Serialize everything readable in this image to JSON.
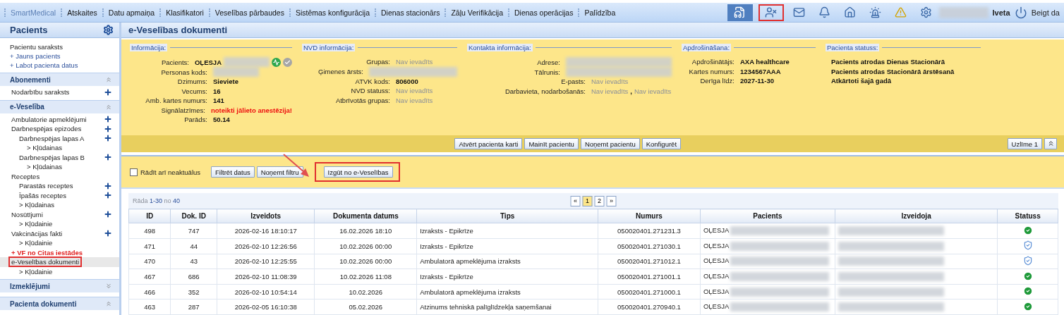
{
  "top_nav": {
    "brand": "SmartMedical",
    "items": [
      "Atskaites",
      "Datu apmaiņa",
      "Klasifikatori",
      "Veselības pārbaudes",
      "Sistēmas konfigurācija",
      "Dienas stacionārs",
      "Zāļu Verifikācija",
      "Dienas operācijas",
      "Palīdzība"
    ],
    "tools": [
      {
        "kind": "dictation",
        "active": true,
        "highlighted": false
      },
      {
        "kind": "patient-off",
        "active": false,
        "highlighted": true
      },
      {
        "kind": "mail",
        "active": false,
        "highlighted": false
      },
      {
        "kind": "bell",
        "active": false,
        "highlighted": false
      },
      {
        "kind": "home",
        "active": false,
        "highlighted": false
      },
      {
        "kind": "siren",
        "active": false,
        "highlighted": false
      },
      {
        "kind": "warning",
        "active": false,
        "highlighted": false
      },
      {
        "kind": "gear",
        "active": false,
        "highlighted": false
      }
    ],
    "user": "Iveta",
    "logout": "Beigt da"
  },
  "sidebar": {
    "title": "Pacients",
    "links": [
      {
        "text": "Pacientu saraksts",
        "kind": "plain"
      },
      {
        "text": "+ Jauns pacients",
        "kind": "link"
      },
      {
        "text": "+ Labot pacienta datus",
        "kind": "link"
      }
    ],
    "sections": [
      {
        "title": "Abonementi",
        "expanded": true,
        "items": [
          {
            "text": "Nodarbību saraksts",
            "add": true,
            "selected": false,
            "highlighted": false,
            "kind": "plain"
          }
        ]
      },
      {
        "title": "e-Veselība",
        "expanded": true,
        "items": [
          {
            "text": "Ambulatorie apmeklējumi",
            "add": true,
            "selected": false,
            "highlighted": false,
            "kind": "plain"
          },
          {
            "text": "Darbnespējas epizodes",
            "add": true,
            "selected": false,
            "highlighted": false,
            "kind": "plain",
            "children": [
              {
                "text": "Darbnespējas lapas A",
                "add": true,
                "selected": false,
                "highlighted": false,
                "kind": "plain",
                "children": [
                  {
                    "text": "> Kļūdainas",
                    "add": false,
                    "selected": false,
                    "highlighted": false,
                    "kind": "plain"
                  }
                ]
              },
              {
                "text": "Darbnespējas lapas B",
                "add": true,
                "selected": false,
                "highlighted": false,
                "kind": "plain",
                "children": [
                  {
                    "text": "> Kļūdainas",
                    "add": false,
                    "selected": false,
                    "highlighted": false,
                    "kind": "plain"
                  }
                ]
              }
            ]
          },
          {
            "text": "Receptes",
            "add": false,
            "selected": false,
            "highlighted": false,
            "kind": "plain",
            "children": [
              {
                "text": "Parastās receptes",
                "add": true,
                "selected": false,
                "highlighted": false,
                "kind": "plain"
              },
              {
                "text": "Īpašās receptes",
                "add": true,
                "selected": false,
                "highlighted": false,
                "kind": "plain"
              },
              {
                "text": "> Kļūdainas",
                "add": false,
                "selected": false,
                "highlighted": false,
                "kind": "plain"
              }
            ]
          },
          {
            "text": "Nosūtījumi",
            "add": true,
            "selected": false,
            "highlighted": false,
            "kind": "plain",
            "children": [
              {
                "text": "> Kļūdainie",
                "add": false,
                "selected": false,
                "highlighted": false,
                "kind": "plain"
              }
            ]
          },
          {
            "text": "Vakcinācijas fakti",
            "add": true,
            "selected": false,
            "highlighted": false,
            "kind": "plain",
            "children": [
              {
                "text": "> Kļūdainie",
                "add": false,
                "selected": false,
                "highlighted": false,
                "kind": "plain"
              }
            ]
          },
          {
            "text": "+ VF no Citas iestādes",
            "add": false,
            "selected": false,
            "highlighted": false,
            "kind": "alert"
          },
          {
            "text": "e-Veselības dokumenti",
            "add": false,
            "selected": true,
            "highlighted": true,
            "kind": "plain",
            "children": [
              {
                "text": "> Kļūdainie",
                "add": false,
                "selected": false,
                "highlighted": false,
                "kind": "plain"
              }
            ]
          }
        ]
      },
      {
        "title": "Izmeklējumi",
        "expanded": false
      },
      {
        "title": "Pacienta dokumenti",
        "expanded": true
      }
    ]
  },
  "page": {
    "title": "e-Veselības dokumenti",
    "info_groups": [
      {
        "title": "Informācija:",
        "fields": [
          {
            "label": "Pacients:",
            "parts": [
              {
                "text": "OĻESJA",
                "kind": "bold"
              },
              {
                "kind": "redacted"
              },
              {
                "kind": "signal-icon"
              },
              {
                "kind": "check-icon"
              }
            ]
          },
          {
            "label": "Personas kods:",
            "parts": [
              {
                "kind": "redacted"
              }
            ]
          },
          {
            "label": "Dzimums:",
            "parts": [
              {
                "text": "Sieviete",
                "kind": "bold"
              }
            ]
          },
          {
            "label": "Vecums:",
            "parts": [
              {
                "text": "16",
                "kind": "bold"
              }
            ]
          },
          {
            "label": "Amb. kartes numurs:",
            "parts": [
              {
                "text": "141",
                "kind": "bold"
              }
            ]
          },
          {
            "label": "Signālatzīmes:",
            "parts": [
              {
                "text": "noteikti jālieto anestēzija!",
                "kind": "alert"
              }
            ]
          },
          {
            "label": "Parāds:",
            "parts": [
              {
                "text": "50.14",
                "kind": "bold"
              }
            ]
          }
        ]
      },
      {
        "title": "NVD informācija:",
        "fields": [
          {
            "label": "Grupas:",
            "parts": [
              {
                "text": "Nav ievadīts",
                "kind": "muted"
              }
            ]
          },
          {
            "label": "Ģimenes ārsts:",
            "parts": [
              {
                "kind": "redacted"
              }
            ]
          },
          {
            "label": "ATVK kods:",
            "parts": [
              {
                "text": "806000",
                "kind": "bold"
              }
            ]
          },
          {
            "label": "NVD statuss:",
            "parts": [
              {
                "text": "Nav ievadīts",
                "kind": "muted"
              }
            ]
          },
          {
            "label": "Atbrīvotās grupas:",
            "parts": [
              {
                "text": "Nav ievadīts",
                "kind": "muted"
              }
            ]
          }
        ]
      },
      {
        "title": "Kontakta informācija:",
        "fields": [
          {
            "label": "Adrese:",
            "parts": [
              {
                "kind": "redacted"
              }
            ]
          },
          {
            "label": "Tālrunis:",
            "parts": [
              {
                "kind": "redacted"
              }
            ]
          },
          {
            "label": "E-pasts:",
            "parts": [
              {
                "text": "Nav ievadīts",
                "kind": "muted"
              }
            ]
          },
          {
            "label": "Darbavieta, nodarbošanās:",
            "parts": [
              {
                "text": "Nav ievadīts",
                "kind": "muted"
              },
              {
                "text": ",",
                "kind": "bold"
              },
              {
                "text": "Nav ievadīts",
                "kind": "muted"
              }
            ]
          }
        ]
      },
      {
        "title": "Apdrošināšana:",
        "fields": [
          {
            "label": "Apdrošinātājs:",
            "parts": [
              {
                "text": "AXA healthcare",
                "kind": "bold"
              }
            ]
          },
          {
            "label": "Kartes numurs:",
            "parts": [
              {
                "text": "1234567AAA",
                "kind": "bold"
              }
            ]
          },
          {
            "label": "Derīga līdz:",
            "parts": [
              {
                "text": "2027-11-30",
                "kind": "bold"
              }
            ]
          }
        ]
      },
      {
        "title": "Pacienta statuss:",
        "fields": [
          {
            "parts": [
              {
                "text": "Pacients atrodas Dienas Stacionārā",
                "kind": "bold"
              }
            ]
          },
          {
            "parts": [
              {
                "text": "Pacients atrodas Stacionārā ārstēsanā",
                "kind": "bold"
              }
            ]
          },
          {
            "parts": [
              {
                "text": "Atkārtoti šajā gadā",
                "kind": "bold"
              }
            ]
          }
        ]
      }
    ],
    "patient_buttons": [
      "Atvērt pacienta karti",
      "Mainīt pacientu",
      "Noņemt pacientu",
      "Konfigurēt"
    ],
    "sticker_button": "Uzlīme 1",
    "filter": {
      "checkbox": {
        "label": "Rādīt arī neaktuālus",
        "checked": false
      },
      "buttons": [
        {
          "text": "Filtrēt datus",
          "highlighted": false
        },
        {
          "text": "Noņemt filtru",
          "highlighted": false
        },
        {
          "text": "Izgūt no e-Veselības",
          "highlighted": true
        }
      ]
    },
    "range": {
      "prefix": "Rāda",
      "span": "1-30",
      "middle": "no",
      "total": "40"
    },
    "pager": [
      {
        "text": "«",
        "selected": false
      },
      {
        "text": "1",
        "selected": true
      },
      {
        "text": "2",
        "selected": false
      },
      {
        "text": "»",
        "selected": false
      }
    ],
    "table": {
      "columns": [
        "ID",
        "Dok. ID",
        "Izveidots",
        "Dokumenta datums",
        "Tips",
        "Numurs",
        "Pacients",
        "Izveidoja",
        "Statuss"
      ],
      "rows": [
        {
          "id": "498",
          "doc_id": "747",
          "created": "2026-02-16 18:10:17",
          "doc_date": "16.02.2026 18:10",
          "type": "Izraksts - Epikrīze",
          "number": "050020401.271231.3",
          "patient": "OĻESJA",
          "kind": "ok"
        },
        {
          "id": "471",
          "doc_id": "44",
          "created": "2026-02-10 12:26:56",
          "doc_date": "10.02.2026 00:00",
          "type": "Izraksts - Epikrīze",
          "number": "050020401.271030.1",
          "patient": "OĻESJA",
          "kind": "pending"
        },
        {
          "id": "470",
          "doc_id": "43",
          "created": "2026-02-10 12:25:55",
          "doc_date": "10.02.2026 00:00",
          "type": "Ambulatorā apmeklējuma izraksts",
          "number": "050020401.271012.1",
          "patient": "OĻESJA",
          "kind": "pending"
        },
        {
          "id": "467",
          "doc_id": "686",
          "created": "2026-02-10 11:08:39",
          "doc_date": "10.02.2026 11:08",
          "type": "Izraksts - Epikrīze",
          "number": "050020401.271001.1",
          "patient": "OĻESJA",
          "kind": "ok"
        },
        {
          "id": "466",
          "doc_id": "352",
          "created": "2026-02-10 10:54:14",
          "doc_date": "10.02.2026",
          "type": "Ambulatorā apmeklējuma izraksts",
          "number": "050020401.271000.1",
          "patient": "OĻESJA",
          "kind": "ok"
        },
        {
          "id": "463",
          "doc_id": "287",
          "created": "2026-02-05 16:10:38",
          "doc_date": "05.02.2026",
          "type": "Atzinums tehniskā palīglīdzekļa saņemšanai",
          "number": "050020401.270940.1",
          "patient": "OĻESJA",
          "kind": "ok"
        }
      ]
    }
  }
}
